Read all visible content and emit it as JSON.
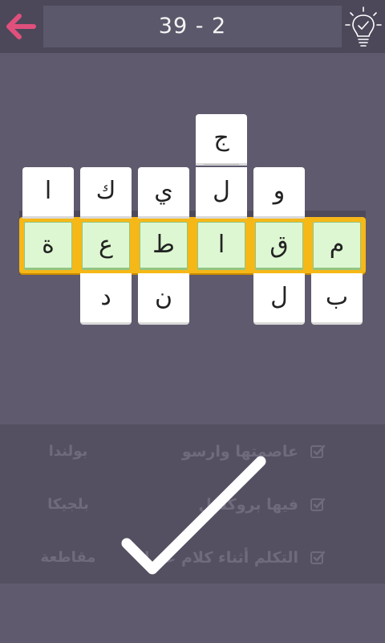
{
  "header": {
    "level_text": "39 - 2",
    "back_icon": "back-arrow-icon",
    "hint_icon": "lightbulb-check-icon",
    "back_color": "#e0507c"
  },
  "board": {
    "highlight_color": "#f6b817",
    "solved_tile_color": "#ddf7d2",
    "columns": [
      {
        "above": [
          "ا"
        ],
        "center": "ة",
        "below": []
      },
      {
        "above": [
          "ك"
        ],
        "center": "ع",
        "below": [
          "د"
        ]
      },
      {
        "above": [
          "ي"
        ],
        "center": "ط",
        "below": [
          "ن"
        ]
      },
      {
        "above": [
          "ج",
          "ل"
        ],
        "center": "ا",
        "below": []
      },
      {
        "above": [
          "و"
        ],
        "center": "ق",
        "below": [
          "ل"
        ]
      },
      {
        "above": [],
        "center": "م",
        "below": [
          "ب"
        ]
      }
    ]
  },
  "clues": [
    {
      "text": "عاصمتها وارسو",
      "answer": "بولندا",
      "checked": true
    },
    {
      "text": "فيها بروكسل",
      "answer": "بلجيكا",
      "checked": true
    },
    {
      "text": "التكلم أثناء كلام غيرك",
      "answer": "مقاطعة",
      "checked": true
    }
  ],
  "success_icon": "large-checkmark-icon"
}
